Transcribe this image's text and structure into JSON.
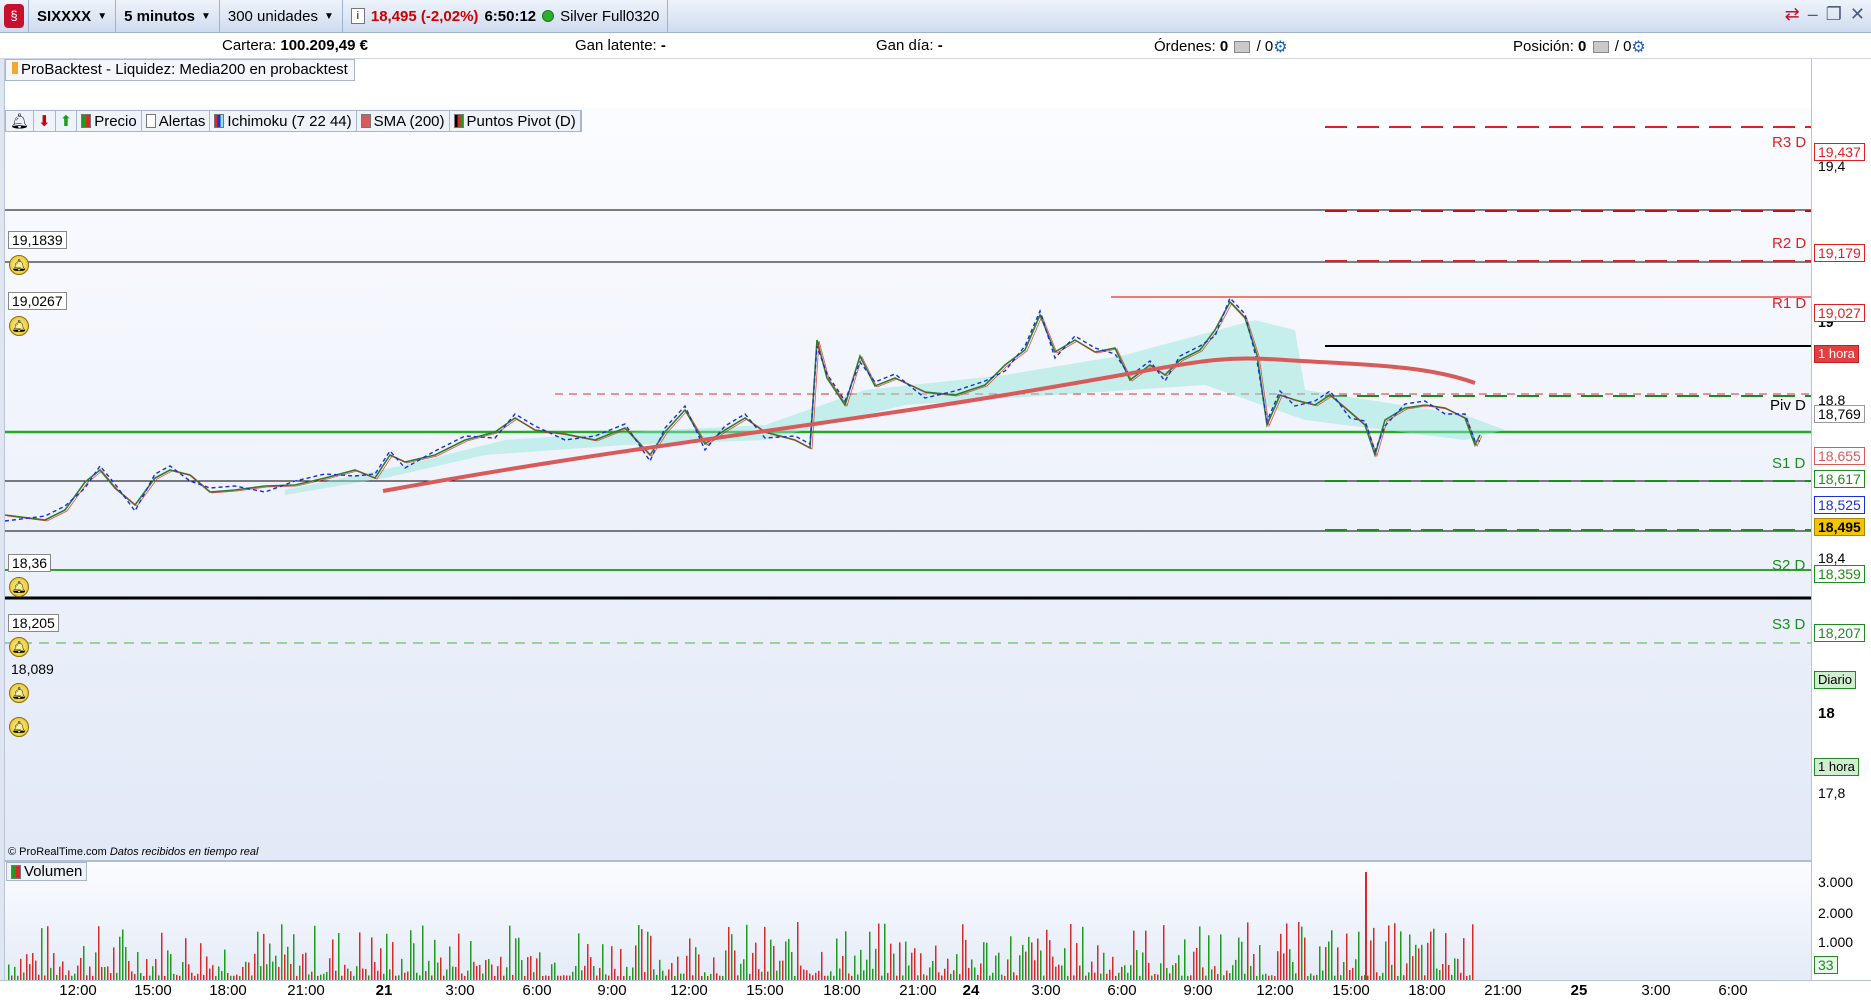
{
  "toolbar": {
    "symbol": "SIXXXX",
    "timeframe": "5 minutos",
    "units": "300 unidades",
    "price_change": "18,495 (-2,02%)",
    "time": "6:50:12",
    "account": "Silver Full0320"
  },
  "infobar": {
    "portfolio_label": "Cartera:",
    "portfolio_value": "100.209,49 €",
    "latent_label": "Gan latente:",
    "latent_value": "-",
    "day_label": "Gan día:",
    "day_value": "-",
    "orders_label": "Órdenes:",
    "orders_value": "0",
    "orders_total": "/ 0",
    "position_label": "Posición:",
    "position_value": "0",
    "position_total": "/ 0"
  },
  "strategy_label": "ProBacktest - Liquidez: Media200 en probacktest",
  "legend": [
    "Precio",
    "Alertas",
    "Ichimoku (7 22 44)",
    "SMA (200)",
    "Puntos Pivot (D)"
  ],
  "footer_credit": "© ProRealTime.com",
  "footer_realtime": "Datos recibidos en tiempo real",
  "volume_label": "Volumen",
  "alert_levels": [
    "19,1839",
    "19,0267",
    "18,36",
    "18,205",
    "18,089"
  ],
  "pivots": [
    {
      "label": "R3 D",
      "value": "19,437",
      "color": "#e02020"
    },
    {
      "label": "R2 D",
      "value": "19,179",
      "color": "#e02020"
    },
    {
      "label": "R1 D",
      "value": "19,027",
      "color": "#e02020"
    },
    {
      "label": "Piv D",
      "value": "18,769",
      "color": "#000000"
    },
    {
      "label": "S1 D",
      "value": "18,617",
      "color": "#1f8a1f"
    },
    {
      "label": "S2 D",
      "value": "18,359",
      "color": "#1f8a1f"
    },
    {
      "label": "S3 D",
      "value": "18,207",
      "color": "#1f8a1f"
    }
  ],
  "axis_tags": {
    "hora_top": "1 hora",
    "sma": "18,655",
    "tenkan": "18,525",
    "last": "18,495",
    "diario": "Diario",
    "hora_bottom": "1 hora",
    "vol_last": "33"
  },
  "price_ticks": [
    "19,4",
    "19",
    "18,8",
    "18,4",
    "18",
    "17,8"
  ],
  "volume_ticks": [
    "3.000",
    "2.000",
    "1.000"
  ],
  "x_ticks": [
    "12:00",
    "15:00",
    "18:00",
    "21:00",
    "21",
    "3:00",
    "6:00",
    "9:00",
    "12:00",
    "15:00",
    "18:00",
    "21:00",
    "24",
    "3:00",
    "6:00",
    "9:00",
    "12:00",
    "15:00",
    "18:00",
    "21:00",
    "25",
    "3:00",
    "6:00"
  ],
  "colors": {
    "bull": "#1e9a1e",
    "bear": "#d42a2a",
    "sma": "#d85a5a",
    "kijun": "#1b2fd6",
    "cloud": "#8fe6d6"
  }
}
